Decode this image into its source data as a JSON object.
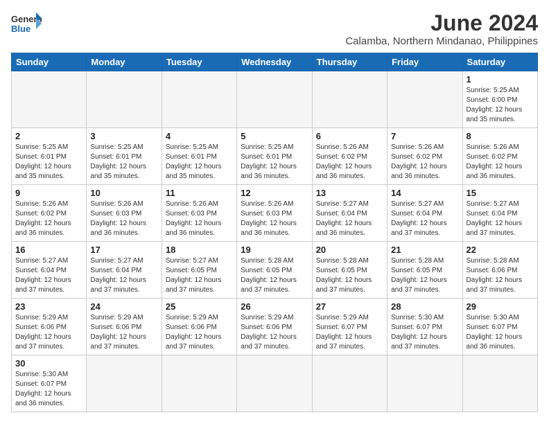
{
  "header": {
    "logo_general": "General",
    "logo_blue": "Blue",
    "month": "June 2024",
    "location": "Calamba, Northern Mindanao, Philippines"
  },
  "weekdays": [
    "Sunday",
    "Monday",
    "Tuesday",
    "Wednesday",
    "Thursday",
    "Friday",
    "Saturday"
  ],
  "weeks": [
    [
      {
        "day": "",
        "info": ""
      },
      {
        "day": "",
        "info": ""
      },
      {
        "day": "",
        "info": ""
      },
      {
        "day": "",
        "info": ""
      },
      {
        "day": "",
        "info": ""
      },
      {
        "day": "",
        "info": ""
      },
      {
        "day": "1",
        "info": "Sunrise: 5:25 AM\nSunset: 6:00 PM\nDaylight: 12 hours and 35 minutes."
      }
    ],
    [
      {
        "day": "2",
        "info": "Sunrise: 5:25 AM\nSunset: 6:01 PM\nDaylight: 12 hours and 35 minutes."
      },
      {
        "day": "3",
        "info": "Sunrise: 5:25 AM\nSunset: 6:01 PM\nDaylight: 12 hours and 35 minutes."
      },
      {
        "day": "4",
        "info": "Sunrise: 5:25 AM\nSunset: 6:01 PM\nDaylight: 12 hours and 35 minutes."
      },
      {
        "day": "5",
        "info": "Sunrise: 5:25 AM\nSunset: 6:01 PM\nDaylight: 12 hours and 36 minutes."
      },
      {
        "day": "6",
        "info": "Sunrise: 5:26 AM\nSunset: 6:02 PM\nDaylight: 12 hours and 36 minutes."
      },
      {
        "day": "7",
        "info": "Sunrise: 5:26 AM\nSunset: 6:02 PM\nDaylight: 12 hours and 36 minutes."
      },
      {
        "day": "8",
        "info": "Sunrise: 5:26 AM\nSunset: 6:02 PM\nDaylight: 12 hours and 36 minutes."
      }
    ],
    [
      {
        "day": "9",
        "info": "Sunrise: 5:26 AM\nSunset: 6:02 PM\nDaylight: 12 hours and 36 minutes."
      },
      {
        "day": "10",
        "info": "Sunrise: 5:26 AM\nSunset: 6:03 PM\nDaylight: 12 hours and 36 minutes."
      },
      {
        "day": "11",
        "info": "Sunrise: 5:26 AM\nSunset: 6:03 PM\nDaylight: 12 hours and 36 minutes."
      },
      {
        "day": "12",
        "info": "Sunrise: 5:26 AM\nSunset: 6:03 PM\nDaylight: 12 hours and 36 minutes."
      },
      {
        "day": "13",
        "info": "Sunrise: 5:27 AM\nSunset: 6:04 PM\nDaylight: 12 hours and 36 minutes."
      },
      {
        "day": "14",
        "info": "Sunrise: 5:27 AM\nSunset: 6:04 PM\nDaylight: 12 hours and 37 minutes."
      },
      {
        "day": "15",
        "info": "Sunrise: 5:27 AM\nSunset: 6:04 PM\nDaylight: 12 hours and 37 minutes."
      }
    ],
    [
      {
        "day": "16",
        "info": "Sunrise: 5:27 AM\nSunset: 6:04 PM\nDaylight: 12 hours and 37 minutes."
      },
      {
        "day": "17",
        "info": "Sunrise: 5:27 AM\nSunset: 6:04 PM\nDaylight: 12 hours and 37 minutes."
      },
      {
        "day": "18",
        "info": "Sunrise: 5:27 AM\nSunset: 6:05 PM\nDaylight: 12 hours and 37 minutes."
      },
      {
        "day": "19",
        "info": "Sunrise: 5:28 AM\nSunset: 6:05 PM\nDaylight: 12 hours and 37 minutes."
      },
      {
        "day": "20",
        "info": "Sunrise: 5:28 AM\nSunset: 6:05 PM\nDaylight: 12 hours and 37 minutes."
      },
      {
        "day": "21",
        "info": "Sunrise: 5:28 AM\nSunset: 6:05 PM\nDaylight: 12 hours and 37 minutes."
      },
      {
        "day": "22",
        "info": "Sunrise: 5:28 AM\nSunset: 6:06 PM\nDaylight: 12 hours and 37 minutes."
      }
    ],
    [
      {
        "day": "23",
        "info": "Sunrise: 5:29 AM\nSunset: 6:06 PM\nDaylight: 12 hours and 37 minutes."
      },
      {
        "day": "24",
        "info": "Sunrise: 5:29 AM\nSunset: 6:06 PM\nDaylight: 12 hours and 37 minutes."
      },
      {
        "day": "25",
        "info": "Sunrise: 5:29 AM\nSunset: 6:06 PM\nDaylight: 12 hours and 37 minutes."
      },
      {
        "day": "26",
        "info": "Sunrise: 5:29 AM\nSunset: 6:06 PM\nDaylight: 12 hours and 37 minutes."
      },
      {
        "day": "27",
        "info": "Sunrise: 5:29 AM\nSunset: 6:07 PM\nDaylight: 12 hours and 37 minutes."
      },
      {
        "day": "28",
        "info": "Sunrise: 5:30 AM\nSunset: 6:07 PM\nDaylight: 12 hours and 37 minutes."
      },
      {
        "day": "29",
        "info": "Sunrise: 5:30 AM\nSunset: 6:07 PM\nDaylight: 12 hours and 36 minutes."
      }
    ],
    [
      {
        "day": "30",
        "info": "Sunrise: 5:30 AM\nSunset: 6:07 PM\nDaylight: 12 hours and 36 minutes."
      },
      {
        "day": "",
        "info": ""
      },
      {
        "day": "",
        "info": ""
      },
      {
        "day": "",
        "info": ""
      },
      {
        "day": "",
        "info": ""
      },
      {
        "day": "",
        "info": ""
      },
      {
        "day": "",
        "info": ""
      }
    ]
  ]
}
